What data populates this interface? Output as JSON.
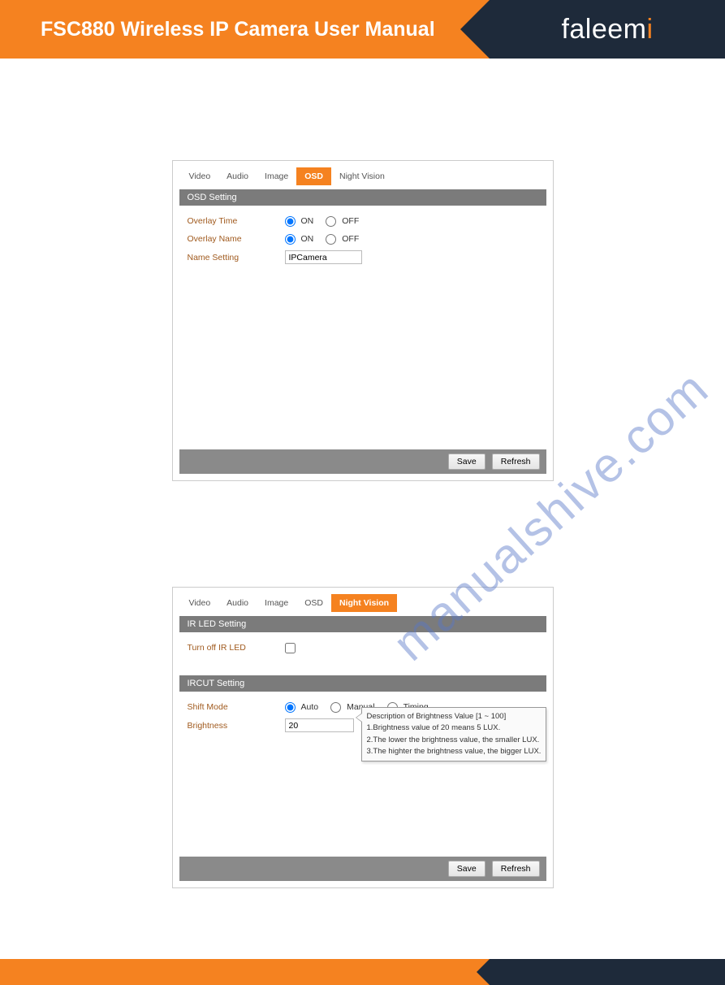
{
  "header": {
    "title": "FSC880 Wireless IP Camera User Manual",
    "logo": "faleemi"
  },
  "watermark": "manualshive.com",
  "screenshot1": {
    "tabs": [
      "Video",
      "Audio",
      "Image",
      "OSD",
      "Night Vision"
    ],
    "active_tab": "OSD",
    "section_title": "OSD Setting",
    "rows": {
      "overlay_time": {
        "label": "Overlay Time",
        "on": "ON",
        "off": "OFF"
      },
      "overlay_name": {
        "label": "Overlay Name",
        "on": "ON",
        "off": "OFF"
      },
      "name_setting": {
        "label": "Name Setting",
        "value": "IPCamera"
      }
    },
    "buttons": {
      "save": "Save",
      "refresh": "Refresh"
    }
  },
  "screenshot2": {
    "tabs": [
      "Video",
      "Audio",
      "Image",
      "OSD",
      "Night Vision"
    ],
    "active_tab": "Night Vision",
    "section1_title": "IR LED Setting",
    "ir_led": {
      "label": "Turn off IR LED"
    },
    "section2_title": "IRCUT Setting",
    "shift_mode": {
      "label": "Shift Mode",
      "auto": "Auto",
      "manual": "Manual",
      "timing": "Timing"
    },
    "brightness": {
      "label": "Brightness",
      "value": "20"
    },
    "tooltip": {
      "line0": "Description of Brightness Value [1 ~ 100]",
      "line1": "1.Brightness value of 20 means 5 LUX.",
      "line2": "2.The lower the brightness value, the smaller LUX.",
      "line3": "3.The highter the brightness value, the bigger LUX."
    },
    "buttons": {
      "save": "Save",
      "refresh": "Refresh"
    }
  }
}
